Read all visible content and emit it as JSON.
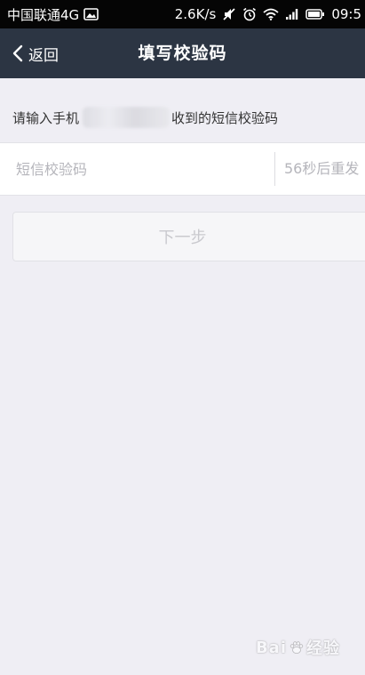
{
  "status_bar": {
    "carrier": "中国联通4G",
    "network_speed": "2.6K/s",
    "time": "09:5",
    "icons": [
      "image-icon",
      "mute-icon",
      "alarm-icon",
      "wifi-icon",
      "signal-icon",
      "battery-icon"
    ]
  },
  "nav": {
    "back_label": "返回",
    "title": "填写校验码"
  },
  "instruction": {
    "prefix": "请输入手机",
    "suffix": "收到的短信校验码"
  },
  "input": {
    "value": "",
    "placeholder": "短信校验码",
    "resend_text": "56秒后重发"
  },
  "next_button": {
    "label": "下一步"
  },
  "watermark": {
    "text_bai": "Bai",
    "text_jingyan": "经验"
  },
  "colors": {
    "status_bar_bg": "#050505",
    "nav_bg": "#2c3543",
    "page_bg": "#efeef4",
    "placeholder": "#b5b5bb",
    "disabled_button_text": "#c9c9ce"
  }
}
